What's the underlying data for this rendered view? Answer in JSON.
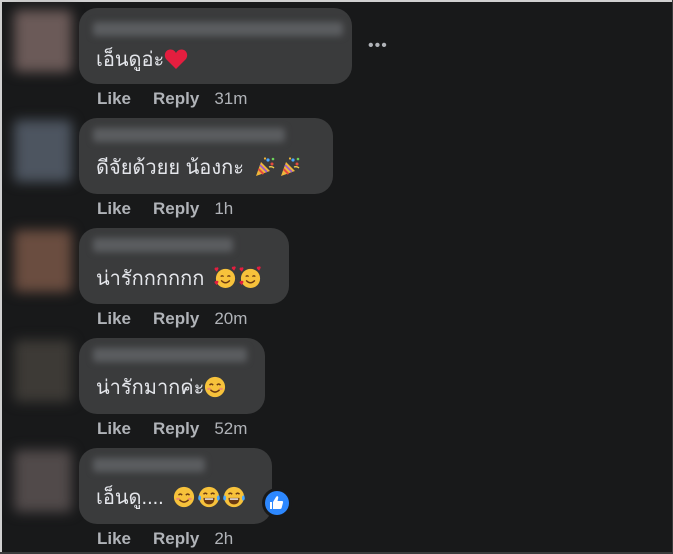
{
  "comments": [
    {
      "text": "เอ็นดูอ่ะ",
      "emoji": [
        "red-heart"
      ],
      "actions": {
        "like": "Like",
        "reply": "Reply",
        "time": "31m"
      }
    },
    {
      "text": "ดีจัยด้วยย น้องกะ",
      "emoji": [
        "party-popper",
        "party-popper"
      ],
      "actions": {
        "like": "Like",
        "reply": "Reply",
        "time": "1h"
      }
    },
    {
      "text": "น่ารักกกกกก",
      "emoji": [
        "smiling-face-with-hearts",
        "smiling-face-with-hearts"
      ],
      "actions": {
        "like": "Like",
        "reply": "Reply",
        "time": "20m"
      }
    },
    {
      "text": "น่ารักมากค่ะ",
      "emoji": [
        "smiling-face-with-smiling-eyes"
      ],
      "actions": {
        "like": "Like",
        "reply": "Reply",
        "time": "52m"
      }
    },
    {
      "text": "เอ็นดู....",
      "emoji": [
        "smiling-face-with-smiling-eyes",
        "face-with-tears-of-joy",
        "face-with-tears-of-joy"
      ],
      "actions": {
        "like": "Like",
        "reply": "Reply",
        "time": "2h"
      },
      "reaction": "like"
    }
  ],
  "more_menu": "•••",
  "colors": {
    "background": "#18191a",
    "bubble": "#3a3b3c",
    "primary_text": "#e4e6eb",
    "secondary_text": "#b0b3b8",
    "like_blue": "#2d88ff",
    "heart_red": "#e41e3f"
  }
}
